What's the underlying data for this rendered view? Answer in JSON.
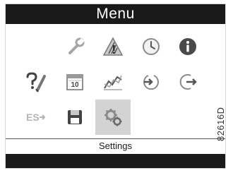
{
  "header": {
    "title": "Menu"
  },
  "menu_grid": {
    "rows": [
      [
        "wrench-icon",
        "warning-triangle-icon",
        "clock-icon",
        "info-icon"
      ],
      [
        "check-tool-icon",
        "calendar-icon",
        "trend-chart-icon",
        "login-icon",
        "logout-icon"
      ],
      [
        "ethernet-settings-icon",
        "save-icon",
        "settings-gear-icon"
      ]
    ],
    "selected": "settings-gear-icon"
  },
  "status": {
    "label": "Settings"
  },
  "figure_id": "82616D",
  "colors": {
    "bar": "#1a1a1a",
    "selected_tile": "#d3d3d3",
    "icon_gray": "#9a9a9a",
    "icon_dark": "#333333"
  }
}
